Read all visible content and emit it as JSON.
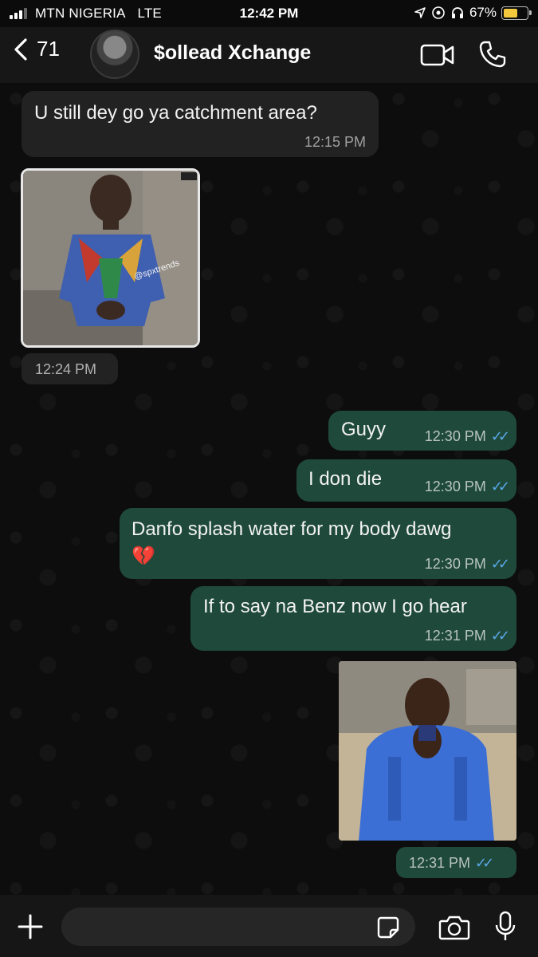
{
  "status_bar": {
    "carrier": "MTN NIGERIA",
    "network": "LTE",
    "time": "12:42 PM",
    "battery_percent": "67%",
    "battery_level": 0.67,
    "icons": [
      "location-icon",
      "alarm-icon",
      "headphones-icon"
    ]
  },
  "header": {
    "back_count": "71",
    "contact_name": "$ollead Xchange"
  },
  "messages": [
    {
      "direction": "incoming",
      "type": "text",
      "text": "U still dey go ya catchment  area?",
      "time": "12:15 PM"
    },
    {
      "direction": "incoming",
      "type": "image",
      "watermark": "@spxtrends",
      "time": "12:24 PM"
    },
    {
      "direction": "outgoing",
      "type": "text",
      "text": "Guyy",
      "time": "12:30 PM",
      "status": "read"
    },
    {
      "direction": "outgoing",
      "type": "text",
      "text": "I don die",
      "time": "12:30 PM",
      "status": "read"
    },
    {
      "direction": "outgoing",
      "type": "text",
      "text": "Danfo splash water for my body dawg",
      "emoji": "💔",
      "time": "12:30 PM",
      "status": "read"
    },
    {
      "direction": "outgoing",
      "type": "text",
      "text": "If to say na Benz now I go hear",
      "time": "12:31 PM",
      "status": "read"
    },
    {
      "direction": "outgoing",
      "type": "image",
      "time": "12:31 PM",
      "status": "read"
    }
  ],
  "composer": {
    "placeholder": ""
  },
  "colors": {
    "outgoing_bubble": "#1f4a3b",
    "incoming_bubble": "#222222",
    "read_ticks": "#5aa7e8",
    "battery": "#f3c83c"
  }
}
